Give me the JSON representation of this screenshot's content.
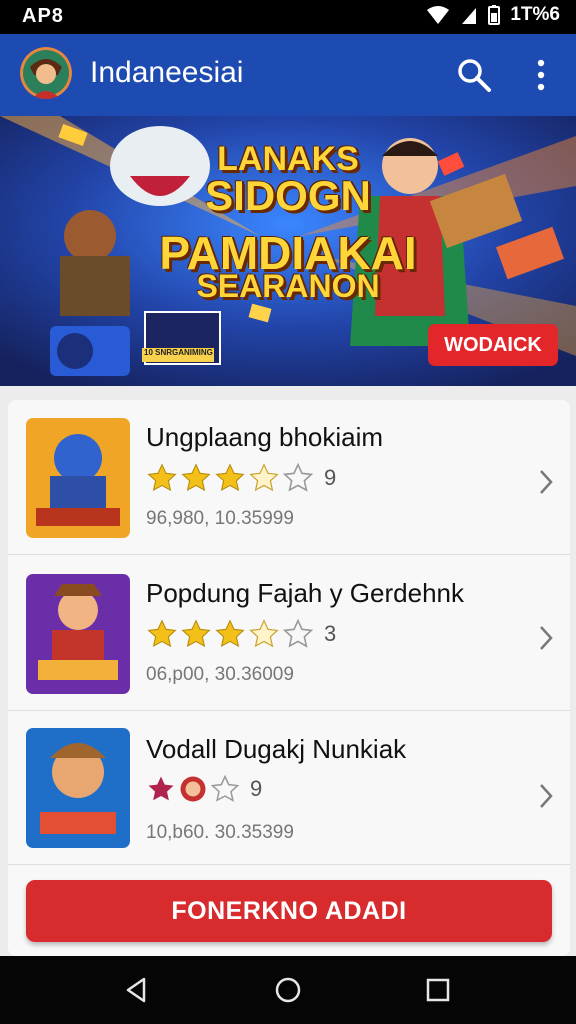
{
  "status_bar": {
    "left_text": "AP8",
    "right_text": "1T%6"
  },
  "app_bar": {
    "title": "Indaneesiai",
    "avatar": "avatar-icon",
    "search_icon": "search-icon",
    "more_icon": "more-vert-icon"
  },
  "banner": {
    "lines": [
      "LANAKS",
      "SIDOGN",
      "PAMDIAKAI",
      "SEARANON"
    ],
    "button": "WODAICK",
    "small_label": "10 SNRGANIMING"
  },
  "list": {
    "items": [
      {
        "title": "Ungplaang bhokiaim",
        "rating": 3.5,
        "rating_count": "9",
        "meta": "96,980, 10.35999"
      },
      {
        "title": "Popdung Fajah y Gerdehnk",
        "rating": 3.5,
        "rating_count": "3",
        "meta": "06,p00, 30.36009"
      },
      {
        "title": "Vodall Dugakj Nunkiak",
        "rating": 2,
        "rating_count": "9",
        "meta": "10,b60. 30.35399"
      }
    ],
    "cta_label": "FONERKNO ADADI"
  },
  "colors": {
    "appbar": "#1e4bb2",
    "accent_red": "#d72b2d",
    "star": "#f3c019"
  }
}
